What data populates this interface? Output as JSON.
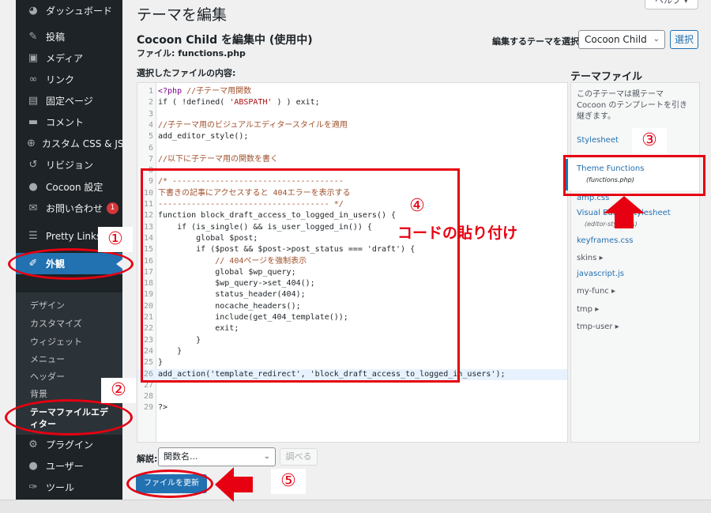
{
  "sidebar": {
    "items": [
      {
        "icon": "dashboard-icon",
        "glyph": "◕",
        "label": "ダッシュボード"
      },
      {
        "icon": "pin-icon",
        "glyph": "✎",
        "label": "投稿"
      },
      {
        "icon": "media-icon",
        "glyph": "▣",
        "label": "メディア"
      },
      {
        "icon": "link-icon",
        "glyph": "∞",
        "label": "リンク"
      },
      {
        "icon": "page-icon",
        "glyph": "▤",
        "label": "固定ページ"
      },
      {
        "icon": "comment-icon",
        "glyph": "▬",
        "label": "コメント"
      },
      {
        "icon": "plus-icon",
        "glyph": "⊕",
        "label": "カスタム CSS & JS"
      },
      {
        "icon": "revision-icon",
        "glyph": "↺",
        "label": "リビジョン"
      },
      {
        "icon": "circle-icon",
        "glyph": "●",
        "label": "Cocoon 設定"
      },
      {
        "icon": "mail-icon",
        "glyph": "✉",
        "label": "お問い合わせ",
        "badge": "1"
      },
      {
        "icon": "pretty-links-icon",
        "glyph": "☰",
        "label": "Pretty Links"
      },
      {
        "icon": "brush-icon",
        "glyph": "✐",
        "label": "外観"
      },
      {
        "icon": "plugin-icon",
        "glyph": "⚙",
        "label": "プラグイン"
      },
      {
        "icon": "user-icon",
        "glyph": "●",
        "label": "ユーザー"
      },
      {
        "icon": "wrench-icon",
        "glyph": "✑",
        "label": "ツール"
      }
    ],
    "submenu": [
      "デザイン",
      "カスタマイズ",
      "ウィジェット",
      "メニュー",
      "ヘッダー",
      "背景",
      "テーマファイルエディター"
    ]
  },
  "page": {
    "title": "テーマを編集",
    "help": "ヘルプ ▾",
    "editing": "Cocoon Child を編集中 (使用中)",
    "file": "ファイル: functions.php",
    "select_label": "編集するテーマを選択:",
    "select_value": "Cocoon Child",
    "select_button": "選択",
    "content_label": "選択したファイルの内容:"
  },
  "code_lines": [
    [
      "1",
      "<?php ",
      "//子テーマ用関数"
    ],
    [
      "2",
      "if ( !defined( ",
      "'ABSPATH'",
      " ) ) exit;"
    ],
    [
      "3",
      ""
    ],
    [
      "4",
      "//子テーマ用のビジュアルエディタースタイルを適用"
    ],
    [
      "5",
      "add_editor_style();"
    ],
    [
      "6",
      ""
    ],
    [
      "7",
      "//以下に子テーマ用の関数を書く"
    ],
    [
      "8",
      ""
    ],
    [
      "9",
      "/* ------------------------------------"
    ],
    [
      "10",
      "下書きの記事にアクセスすると 404エラーを表示する"
    ],
    [
      "11",
      "------------------------------------ */"
    ],
    [
      "12",
      "function block_draft_access_to_logged_in_users() {"
    ],
    [
      "13",
      "    if (is_single() && is_user_logged_in()) {"
    ],
    [
      "14",
      "        global $post;"
    ],
    [
      "15",
      "        if ($post && $post->post_status === 'draft') {"
    ],
    [
      "16",
      "            // 404ページを強制表示"
    ],
    [
      "17",
      "            global $wp_query;"
    ],
    [
      "18",
      "            $wp_query->set_404();"
    ],
    [
      "19",
      "            status_header(404);"
    ],
    [
      "20",
      "            nocache_headers();"
    ],
    [
      "21",
      "            include(get_404_template());"
    ],
    [
      "22",
      "            exit;"
    ],
    [
      "23",
      "        }"
    ],
    [
      "24",
      "    }"
    ],
    [
      "25",
      "}"
    ],
    [
      "26",
      "add_action('template_redirect', 'block_draft_access_to_logged_in_users');"
    ],
    [
      "27",
      ""
    ],
    [
      "28",
      ""
    ],
    [
      "29",
      "?>"
    ]
  ],
  "files": {
    "heading": "テーマファイル",
    "desc": "この子テーマは親テーマ Cocoon のテンプレートを引き継ぎます。",
    "stylesheet": "Stylesheet",
    "current": "Theme Functions",
    "current_sub": "(functions.php)",
    "amp": "amp.css",
    "visual": "Visual Editor Stylesheet",
    "visual_sub": "(editor-style.css)",
    "keyframes": "keyframes.css",
    "skins": "skins ▸",
    "javascript": "javascript.js",
    "myfunc": "my-func ▸",
    "tmp": "tmp ▸",
    "tmpuser": "tmp-user ▸"
  },
  "bottom": {
    "doc_label": "解説:",
    "func_select": "関数名...",
    "lookup": "調べる",
    "update": "ファイルを更新"
  },
  "annotations": {
    "n1": "①",
    "n2": "②",
    "n3": "③",
    "n4": "④",
    "n5": "⑤",
    "paste_note": "コードの貼り付け",
    "color": "#e60012"
  }
}
